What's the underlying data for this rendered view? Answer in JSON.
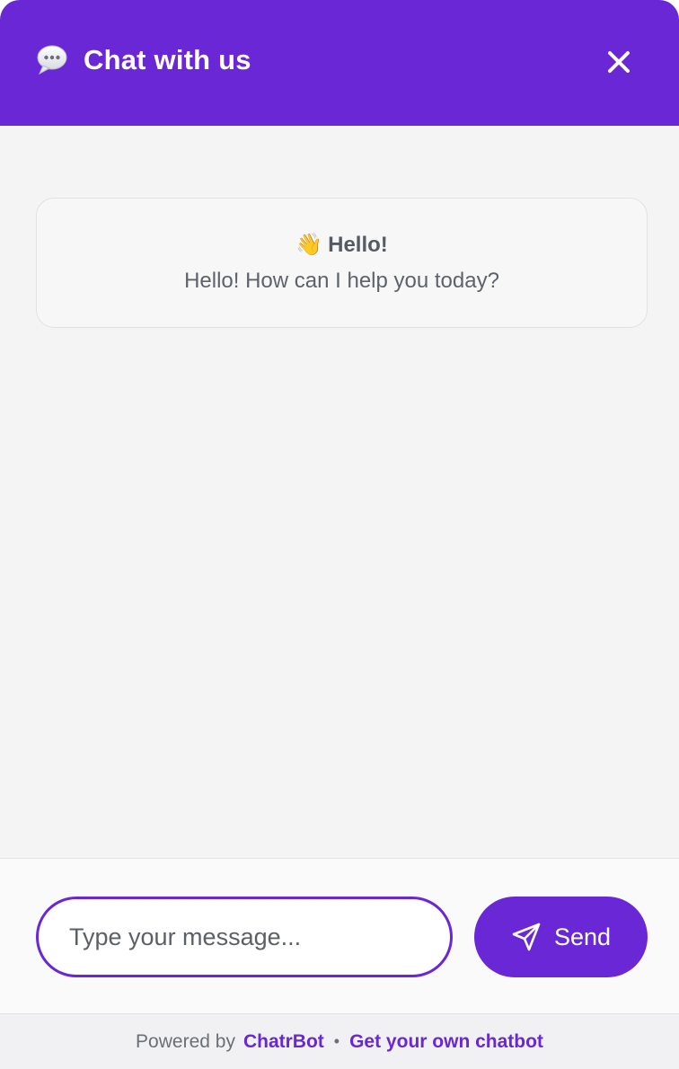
{
  "header": {
    "title": "Chat with us",
    "icon": "speech-bubble-icon",
    "close_icon": "close-icon"
  },
  "welcome": {
    "icon": "waving-hand-icon",
    "emoji": "👋",
    "title": "Hello!",
    "text": "Hello! How can I help you today?"
  },
  "composer": {
    "placeholder": "Type your message...",
    "value": "",
    "send_label": "Send",
    "send_icon": "paper-plane-icon"
  },
  "footer": {
    "powered_label": "Powered by",
    "brand_link": "ChatrBot",
    "separator": "•",
    "cta_link": "Get your own chatbot"
  },
  "colors": {
    "accent": "#6a27d6",
    "background": "#f4f4f5"
  }
}
